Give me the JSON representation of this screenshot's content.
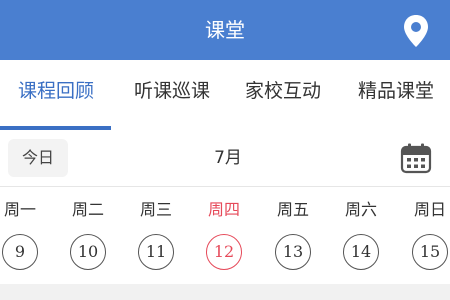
{
  "header": {
    "title": "课堂",
    "location_icon": "location-pin-icon",
    "color": "#4a7fd0"
  },
  "tabs": [
    {
      "label": "课程回顾",
      "active": true
    },
    {
      "label": "听课巡课",
      "active": false
    },
    {
      "label": "家校互动",
      "active": false
    },
    {
      "label": "精品课堂",
      "active": false
    }
  ],
  "toolbar": {
    "today_label": "今日",
    "month_label": "7月",
    "calendar_icon": "calendar-icon"
  },
  "week": {
    "days": [
      "周一",
      "周二",
      "周三",
      "周四",
      "周五",
      "周六",
      "周日"
    ],
    "dates": [
      "9",
      "10",
      "11",
      "12",
      "13",
      "14",
      "15"
    ],
    "today_index": 3,
    "today_color": "#e64a5a"
  },
  "accent_color": "#3a6fc4"
}
